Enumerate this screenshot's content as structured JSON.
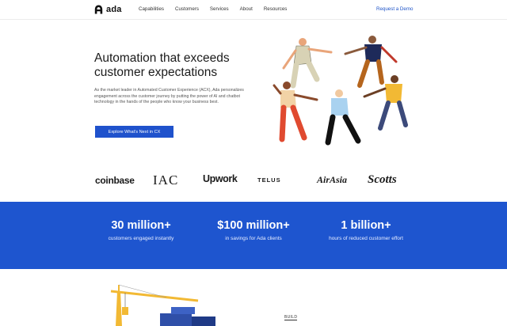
{
  "nav": {
    "logo_text": "ada",
    "links": [
      "Capabilities",
      "Customers",
      "Services",
      "About",
      "Resources"
    ],
    "cta": "Request a Demo"
  },
  "hero": {
    "title": "Automation that exceeds customer expectations",
    "description": "As the market leader in Automated Customer Experience (ACX), Ada personalizes engagement across the customer journey by putting the power of AI and chatbot technology in the hands of the people who know your business best.",
    "button": "Explore What's Next in CX"
  },
  "logos": [
    "coinbase",
    "IAC",
    "Upwork",
    "TELUS",
    "AirAsia",
    "Scotts"
  ],
  "stats": [
    {
      "value": "30 million+",
      "label": "customers engaged instantly"
    },
    {
      "value": "$100 million+",
      "label": "in savings for Ada clients"
    },
    {
      "value": "1 billion+",
      "label": "hours of reduced customer effort"
    }
  ],
  "next_section": {
    "label": "BUILD"
  },
  "colors": {
    "accent": "#1e55cf",
    "nav_cta": "#1e54c8",
    "text": "#1b1b1b"
  }
}
